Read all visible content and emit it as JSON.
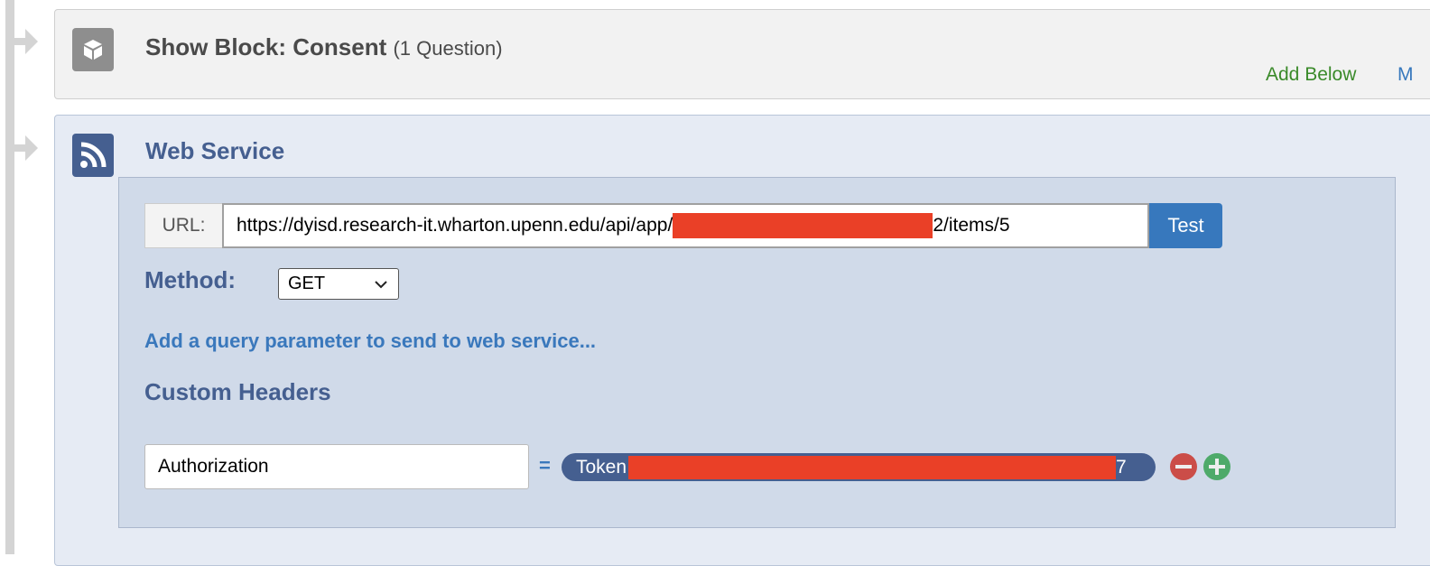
{
  "consent_block": {
    "title": "Show Block: Consent",
    "subtitle": "(1 Question)",
    "icon": "cube-icon",
    "add_below": "Add Below",
    "more_link": "M"
  },
  "web_service": {
    "title": "Web Service",
    "icon": "rss-icon",
    "url_label": "URL:",
    "url_prefix": "https://dyisd.research-it.wharton.upenn.edu/api/app/",
    "url_suffix": "2/items/5",
    "test_label": "Test",
    "method_label": "Method:",
    "method_value": "GET",
    "add_param_link": "Add a query parameter to send to web service...",
    "custom_headers_label": "Custom Headers",
    "header_name": "Authorization",
    "equals": "=",
    "token_prefix": "Token",
    "token_suffix": "7"
  },
  "colors": {
    "accent": "#455f90",
    "link": "#3778bd",
    "redaction": "#ea4027",
    "remove": "#cb4d48",
    "add": "#4eaa6a"
  }
}
